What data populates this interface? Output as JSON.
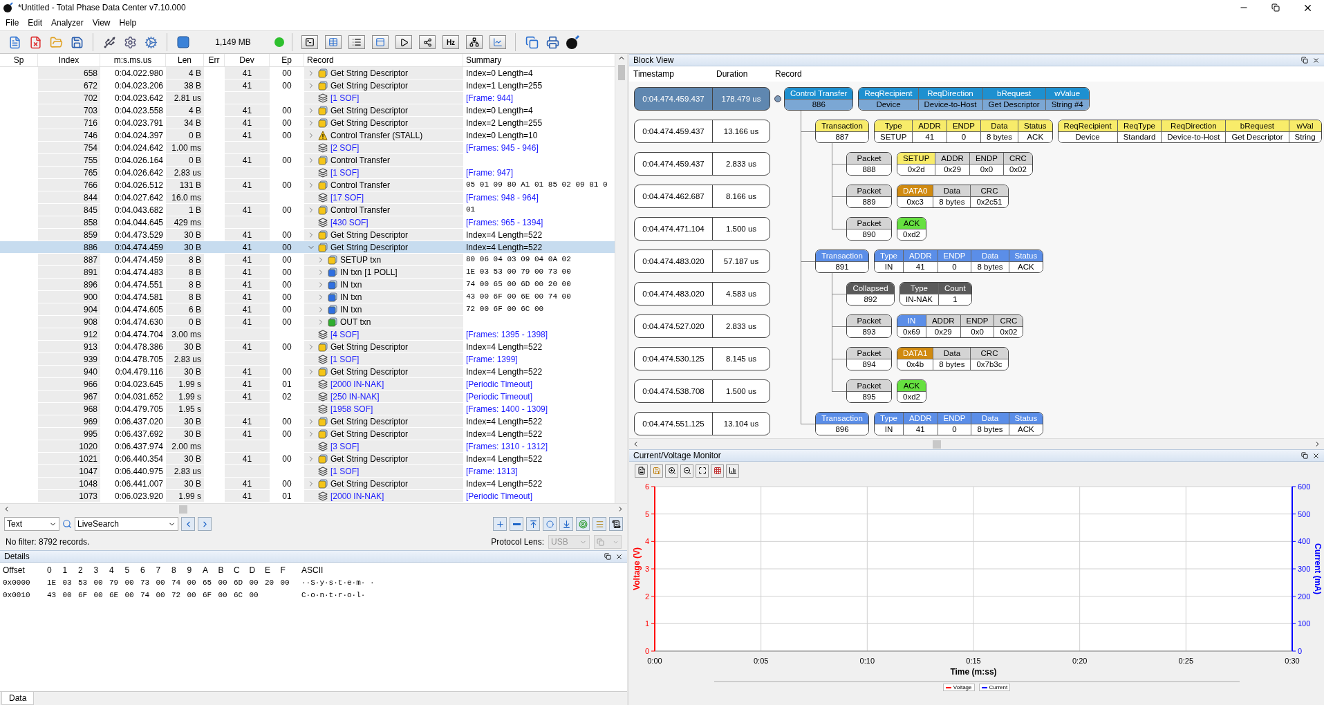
{
  "window": {
    "title": "*Untitled - Total Phase Data Center v7.10.000"
  },
  "menu": [
    "File",
    "Edit",
    "Analyzer",
    "View",
    "Help"
  ],
  "toolbar": {
    "memory": "1,149 MB",
    "frequency_label": "Hz"
  },
  "table": {
    "columns": [
      "Sp",
      "Index",
      "m:s.ms.us",
      "Len",
      "Err",
      "Dev",
      "Ep",
      "Record",
      "Summary"
    ],
    "rows": [
      {
        "index": "658",
        "time": "0:04.022.980",
        "len": "4 B",
        "dev": "41",
        "ep": "00",
        "kind": "transfer",
        "record": "Get String Descriptor",
        "summary": "Index=0 Length=4",
        "summary_mono": false,
        "selected": false,
        "expanded": false
      },
      {
        "index": "672",
        "time": "0:04.023.206",
        "len": "38 B",
        "dev": "41",
        "ep": "00",
        "kind": "transfer",
        "record": "Get String Descriptor",
        "summary": "Index=1 Length=255",
        "summary_mono": false,
        "selected": false,
        "expanded": false
      },
      {
        "index": "702",
        "time": "0:04.023.642",
        "len": "2.81 us",
        "kind": "sof",
        "record": "[1 SOF]",
        "summary": "[Frame: 944]",
        "summary_mono": false,
        "selected": false
      },
      {
        "index": "703",
        "time": "0:04.023.558",
        "len": "4 B",
        "dev": "41",
        "ep": "00",
        "kind": "transfer",
        "record": "Get String Descriptor",
        "summary": "Index=0 Length=4",
        "summary_mono": false,
        "selected": false,
        "expanded": false
      },
      {
        "index": "716",
        "time": "0:04.023.791",
        "len": "34 B",
        "dev": "41",
        "ep": "00",
        "kind": "transfer",
        "record": "Get String Descriptor",
        "summary": "Index=2 Length=255",
        "summary_mono": false,
        "selected": false,
        "expanded": false
      },
      {
        "index": "746",
        "time": "0:04.024.397",
        "len": "0 B",
        "dev": "41",
        "ep": "00",
        "kind": "stall",
        "record": "Control Transfer (STALL)",
        "summary": "Index=0 Length=10",
        "summary_mono": false,
        "selected": false,
        "expanded": false
      },
      {
        "index": "754",
        "time": "0:04.024.642",
        "len": "1.00 ms",
        "kind": "sof",
        "record": "[2 SOF]",
        "summary": "[Frames: 945 - 946]",
        "summary_mono": false,
        "selected": false
      },
      {
        "index": "755",
        "time": "0:04.026.164",
        "len": "0 B",
        "dev": "41",
        "ep": "00",
        "kind": "transfer",
        "record": "Control Transfer",
        "selected": false,
        "expanded": false
      },
      {
        "index": "765",
        "time": "0:04.026.642",
        "len": "2.83 us",
        "kind": "sof",
        "record": "[1 SOF]",
        "summary": "[Frame: 947]",
        "summary_mono": false,
        "selected": false
      },
      {
        "index": "766",
        "time": "0:04.026.512",
        "len": "131 B",
        "dev": "41",
        "ep": "00",
        "kind": "transfer",
        "record": "Control Transfer",
        "summary": "05 01 09 80 A1 01 85 02 09 81 0",
        "summary_mono": true,
        "selected": false,
        "expanded": false
      },
      {
        "index": "844",
        "time": "0:04.027.642",
        "len": "16.0 ms",
        "kind": "sof",
        "record": "[17 SOF]",
        "summary": "[Frames: 948 - 964]",
        "summary_mono": false,
        "selected": false
      },
      {
        "index": "845",
        "time": "0:04.043.682",
        "len": "1 B",
        "dev": "41",
        "ep": "00",
        "kind": "transfer",
        "record": "Control Transfer",
        "summary": "01",
        "summary_mono": true,
        "selected": false,
        "expanded": false
      },
      {
        "index": "858",
        "time": "0:04.044.645",
        "len": "429 ms",
        "kind": "sof",
        "record": "[430 SOF]",
        "summary": "[Frames: 965 - 1394]",
        "summary_mono": false,
        "selected": false
      },
      {
        "index": "859",
        "time": "0:04.473.529",
        "len": "30 B",
        "dev": "41",
        "ep": "00",
        "kind": "transfer",
        "record": "Get String Descriptor",
        "summary": "Index=4 Length=522",
        "summary_mono": false,
        "selected": false,
        "expanded": false
      },
      {
        "index": "886",
        "time": "0:04.474.459",
        "len": "30 B",
        "dev": "41",
        "ep": "00",
        "kind": "transfer",
        "record": "Get String Descriptor",
        "summary": "Index=4 Length=522",
        "summary_mono": false,
        "selected": true,
        "expanded": true,
        "children": [
          {
            "index": "887",
            "time": "0:04.474.459",
            "len": "8 B",
            "dev": "41",
            "ep": "00",
            "kind": "setup",
            "record": "SETUP txn",
            "summary": "80 06 04 03 09 04 0A 02",
            "summary_mono": true,
            "selected": false,
            "expanded": false
          },
          {
            "index": "891",
            "time": "0:04.474.483",
            "len": "8 B",
            "dev": "41",
            "ep": "00",
            "kind": "in",
            "record": "IN txn",
            "tag": "[1 POLL]",
            "summary": "1E 03 53 00 79 00 73 00",
            "summary_mono": true,
            "selected": false,
            "expanded": false
          },
          {
            "index": "896",
            "time": "0:04.474.551",
            "len": "8 B",
            "dev": "41",
            "ep": "00",
            "kind": "in",
            "record": "IN txn",
            "summary": "74 00 65 00 6D 00 20 00",
            "summary_mono": true,
            "selected": false,
            "expanded": false
          },
          {
            "index": "900",
            "time": "0:04.474.581",
            "len": "8 B",
            "dev": "41",
            "ep": "00",
            "kind": "in",
            "record": "IN txn",
            "summary": "43 00 6F 00 6E 00 74 00",
            "summary_mono": true,
            "selected": false,
            "expanded": false
          },
          {
            "index": "904",
            "time": "0:04.474.605",
            "len": "6 B",
            "dev": "41",
            "ep": "00",
            "kind": "in",
            "record": "IN txn",
            "summary": "72 00 6F 00 6C 00",
            "summary_mono": true,
            "selected": false,
            "expanded": false
          },
          {
            "index": "908",
            "time": "0:04.474.630",
            "len": "0 B",
            "dev": "41",
            "ep": "00",
            "kind": "out",
            "record": "OUT txn",
            "selected": false,
            "expanded": false
          }
        ]
      },
      {
        "index": "912",
        "time": "0:04.474.704",
        "len": "3.00 ms",
        "kind": "sof",
        "record": "[4 SOF]",
        "summary": "[Frames: 1395 - 1398]",
        "summary_mono": false,
        "selected": false
      },
      {
        "index": "913",
        "time": "0:04.478.386",
        "len": "30 B",
        "dev": "41",
        "ep": "00",
        "kind": "transfer",
        "record": "Get String Descriptor",
        "summary": "Index=4 Length=522",
        "summary_mono": false,
        "selected": false,
        "expanded": false
      },
      {
        "index": "939",
        "time": "0:04.478.705",
        "len": "2.83 us",
        "kind": "sof",
        "record": "[1 SOF]",
        "summary": "[Frame: 1399]",
        "summary_mono": false,
        "selected": false
      },
      {
        "index": "940",
        "time": "0:04.479.116",
        "len": "30 B",
        "dev": "41",
        "ep": "00",
        "kind": "transfer",
        "record": "Get String Descriptor",
        "summary": "Index=4 Length=522",
        "summary_mono": false,
        "selected": false,
        "expanded": false
      },
      {
        "index": "966",
        "time": "0:04.023.645",
        "len": "1.99 s",
        "dev": "41",
        "ep": "01",
        "kind": "sof",
        "record": "[2000 IN-NAK]",
        "summary": "[Periodic Timeout]",
        "summary_mono": false,
        "selected": false
      },
      {
        "index": "967",
        "time": "0:04.031.652",
        "len": "1.99 s",
        "dev": "41",
        "ep": "02",
        "kind": "sof",
        "record": "[250 IN-NAK]",
        "summary": "[Periodic Timeout]",
        "summary_mono": false,
        "selected": false
      },
      {
        "index": "968",
        "time": "0:04.479.705",
        "len": "1.95 s",
        "kind": "sof",
        "record": "[1958 SOF]",
        "summary": "[Frames: 1400 - 1309]",
        "summary_mono": false,
        "selected": false
      },
      {
        "index": "969",
        "time": "0:06.437.020",
        "len": "30 B",
        "dev": "41",
        "ep": "00",
        "kind": "transfer",
        "record": "Get String Descriptor",
        "summary": "Index=4 Length=522",
        "summary_mono": false,
        "selected": false,
        "expanded": false
      },
      {
        "index": "995",
        "time": "0:06.437.692",
        "len": "30 B",
        "dev": "41",
        "ep": "00",
        "kind": "transfer",
        "record": "Get String Descriptor",
        "summary": "Index=4 Length=522",
        "summary_mono": false,
        "selected": false,
        "expanded": false
      },
      {
        "index": "1020",
        "time": "0:06.437.974",
        "len": "2.00 ms",
        "kind": "sof",
        "record": "[3 SOF]",
        "summary": "[Frames: 1310 - 1312]",
        "summary_mono": false,
        "selected": false
      },
      {
        "index": "1021",
        "time": "0:06.440.354",
        "len": "30 B",
        "dev": "41",
        "ep": "00",
        "kind": "transfer",
        "record": "Get String Descriptor",
        "summary": "Index=4 Length=522",
        "summary_mono": false,
        "selected": false,
        "expanded": false
      },
      {
        "index": "1047",
        "time": "0:06.440.975",
        "len": "2.83 us",
        "kind": "sof",
        "record": "[1 SOF]",
        "summary": "[Frame: 1313]",
        "summary_mono": false,
        "selected": false
      },
      {
        "index": "1048",
        "time": "0:06.441.007",
        "len": "30 B",
        "dev": "41",
        "ep": "00",
        "kind": "transfer",
        "record": "Get String Descriptor",
        "summary": "Index=4 Length=522",
        "summary_mono": false,
        "selected": false,
        "expanded": false
      },
      {
        "index": "1073",
        "time": "0:06.023.920",
        "len": "1.99 s",
        "dev": "41",
        "ep": "01",
        "kind": "sof",
        "record": "[2000 IN-NAK]",
        "summary": "[Periodic Timeout]",
        "summary_mono": false,
        "selected": false
      }
    ]
  },
  "search": {
    "mode": "Text",
    "value": "LiveSearch"
  },
  "status": {
    "text": "No filter: 8792 records.",
    "lens_label": "Protocol Lens:",
    "lens_value": "USB",
    "lens_disabled": true
  },
  "details": {
    "title": "Details",
    "columns": [
      "Offset",
      "0",
      "1",
      "2",
      "3",
      "4",
      "5",
      "6",
      "7",
      "8",
      "9",
      "A",
      "B",
      "C",
      "D",
      "E",
      "F",
      "ASCII"
    ],
    "rows": [
      {
        "offset": "0x0000",
        "bytes": [
          "1E",
          "03",
          "53",
          "00",
          "79",
          "00",
          "73",
          "00",
          "74",
          "00",
          "65",
          "00",
          "6D",
          "00",
          "20",
          "00"
        ],
        "ascii": "··S·y·s·t·e·m· ·"
      },
      {
        "offset": "0x0010",
        "bytes": [
          "43",
          "00",
          "6F",
          "00",
          "6E",
          "00",
          "74",
          "00",
          "72",
          "00",
          "6F",
          "00",
          "6C",
          "00"
        ],
        "ascii": "C·o·n·t·r·o·l·"
      }
    ]
  },
  "bottom_tabs": [
    {
      "label": "Data",
      "selected": true
    }
  ],
  "block_view": {
    "title": "Block View",
    "columns": [
      "Timestamp",
      "Duration",
      "Record"
    ],
    "nodes": [
      {
        "kind": "transfer",
        "timestamp": "0:04.474.459.437",
        "duration": "178.479 us",
        "selected": true,
        "title": "Control Transfer",
        "id": "886",
        "color": "#1e90d0",
        "groups": [
          [
            {
              "label": "ReqRecipient",
              "value": "Device",
              "color": "#1e90d0"
            },
            {
              "label": "ReqDirection",
              "value": "Device-to-Host",
              "color": "#1e90d0"
            },
            {
              "label": "bRequest",
              "value": "Get Descriptor",
              "color": "#1e90d0"
            },
            {
              "label": "wValue",
              "value": "String #4",
              "color": "#1e90d0"
            }
          ]
        ],
        "children": [
          {
            "kind": "transaction",
            "timestamp": "0:04.474.459.437",
            "duration": "13.166 us",
            "selected": false,
            "title": "Transaction",
            "id": "887",
            "color": "#f8ec6a",
            "groups": [
              [
                {
                  "label": "Type",
                  "value": "SETUP",
                  "color": "#f8ec6a"
                },
                {
                  "label": "ADDR",
                  "value": "41",
                  "color": "#f8ec6a"
                },
                {
                  "label": "ENDP",
                  "value": "0",
                  "color": "#f8ec6a"
                },
                {
                  "label": "Data",
                  "value": "8 bytes",
                  "color": "#f8ec6a"
                },
                {
                  "label": "Status",
                  "value": "ACK",
                  "color": "#f8ec6a"
                }
              ],
              [
                {
                  "label": "ReqRecipient",
                  "value": "Device",
                  "color": "#f8ec6a"
                },
                {
                  "label": "ReqType",
                  "value": "Standard",
                  "color": "#f8ec6a"
                },
                {
                  "label": "ReqDirection",
                  "value": "Device-to-Host",
                  "color": "#f8ec6a"
                },
                {
                  "label": "bRequest",
                  "value": "Get Descriptor",
                  "color": "#f8ec6a"
                },
                {
                  "label": "wVal",
                  "value": "String",
                  "color": "#f8ec6a"
                }
              ]
            ],
            "children": [
              {
                "kind": "packet",
                "timestamp": "0:04.474.459.437",
                "duration": "2.833 us",
                "selected": false,
                "title": "Packet",
                "id": "888",
                "color": "#d4d4d4",
                "groups": [
                  [
                    {
                      "label": "SETUP",
                      "value": "0x2d",
                      "color": "#f8ec6a"
                    },
                    {
                      "label": "ADDR",
                      "value": "0x29",
                      "color": "#d4d4d4"
                    },
                    {
                      "label": "ENDP",
                      "value": "0x0",
                      "color": "#d4d4d4"
                    },
                    {
                      "label": "CRC",
                      "value": "0x02",
                      "color": "#d4d4d4"
                    }
                  ]
                ]
              },
              {
                "kind": "packet",
                "timestamp": "0:04.474.462.687",
                "duration": "8.166 us",
                "selected": false,
                "title": "Packet",
                "id": "889",
                "color": "#d4d4d4",
                "groups": [
                  [
                    {
                      "label": "DATA0",
                      "value": "0xc3",
                      "color": "#d08a10"
                    },
                    {
                      "label": "Data",
                      "value": "8 bytes",
                      "color": "#d4d4d4"
                    },
                    {
                      "label": "CRC",
                      "value": "0x2c51",
                      "color": "#d4d4d4"
                    }
                  ]
                ]
              },
              {
                "kind": "packet",
                "timestamp": "0:04.474.471.104",
                "duration": "1.500 us",
                "selected": false,
                "title": "Packet",
                "id": "890",
                "color": "#d4d4d4",
                "groups": [
                  [
                    {
                      "label": "ACK",
                      "value": "0xd2",
                      "color": "#66e040"
                    }
                  ]
                ]
              }
            ]
          },
          {
            "kind": "transaction",
            "timestamp": "0:04.474.483.020",
            "duration": "57.187 us",
            "selected": false,
            "title": "Transaction",
            "id": "891",
            "color": "#5b8ee8",
            "groups": [
              [
                {
                  "label": "Type",
                  "value": "IN",
                  "color": "#5b8ee8"
                },
                {
                  "label": "ADDR",
                  "value": "41",
                  "color": "#5b8ee8"
                },
                {
                  "label": "ENDP",
                  "value": "0",
                  "color": "#5b8ee8"
                },
                {
                  "label": "Data",
                  "value": "8 bytes",
                  "color": "#5b8ee8"
                },
                {
                  "label": "Status",
                  "value": "ACK",
                  "color": "#5b8ee8"
                }
              ]
            ],
            "children": [
              {
                "kind": "collapsed",
                "timestamp": "0:04.474.483.020",
                "duration": "4.583 us",
                "selected": false,
                "title": "Collapsed",
                "id": "892",
                "color": "#5a5a5a",
                "groups": [
                  [
                    {
                      "label": "Type",
                      "value": "IN-NAK",
                      "color": "#5a5a5a"
                    },
                    {
                      "label": "Count",
                      "value": "1",
                      "color": "#5a5a5a"
                    }
                  ]
                ]
              },
              {
                "kind": "packet",
                "timestamp": "0:04.474.527.020",
                "duration": "2.833 us",
                "selected": false,
                "title": "Packet",
                "id": "893",
                "color": "#d4d4d4",
                "groups": [
                  [
                    {
                      "label": "IN",
                      "value": "0x69",
                      "color": "#5b8ee8"
                    },
                    {
                      "label": "ADDR",
                      "value": "0x29",
                      "color": "#d4d4d4"
                    },
                    {
                      "label": "ENDP",
                      "value": "0x0",
                      "color": "#d4d4d4"
                    },
                    {
                      "label": "CRC",
                      "value": "0x02",
                      "color": "#d4d4d4"
                    }
                  ]
                ]
              },
              {
                "kind": "packet",
                "timestamp": "0:04.474.530.125",
                "duration": "8.145 us",
                "selected": false,
                "title": "Packet",
                "id": "894",
                "color": "#d4d4d4",
                "groups": [
                  [
                    {
                      "label": "DATA1",
                      "value": "0x4b",
                      "color": "#d08a10"
                    },
                    {
                      "label": "Data",
                      "value": "8 bytes",
                      "color": "#d4d4d4"
                    },
                    {
                      "label": "CRC",
                      "value": "0x7b3c",
                      "color": "#d4d4d4"
                    }
                  ]
                ]
              },
              {
                "kind": "packet",
                "timestamp": "0:04.474.538.708",
                "duration": "1.500 us",
                "selected": false,
                "title": "Packet",
                "id": "895",
                "color": "#d4d4d4",
                "groups": [
                  [
                    {
                      "label": "ACK",
                      "value": "0xd2",
                      "color": "#66e040"
                    }
                  ]
                ]
              }
            ]
          },
          {
            "kind": "transaction",
            "timestamp": "0:04.474.551.125",
            "duration": "13.104 us",
            "selected": false,
            "title": "Transaction",
            "id": "896",
            "color": "#5b8ee8",
            "groups": [
              [
                {
                  "label": "Type",
                  "value": "IN",
                  "color": "#5b8ee8"
                },
                {
                  "label": "ADDR",
                  "value": "41",
                  "color": "#5b8ee8"
                },
                {
                  "label": "ENDP",
                  "value": "0",
                  "color": "#5b8ee8"
                },
                {
                  "label": "Data",
                  "value": "8 bytes",
                  "color": "#5b8ee8"
                },
                {
                  "label": "Status",
                  "value": "ACK",
                  "color": "#5b8ee8"
                }
              ]
            ]
          }
        ]
      }
    ]
  },
  "monitor": {
    "title": "Current/Voltage Monitor",
    "chart_data": {
      "type": "line",
      "xlabel": "Time (m:ss)",
      "ylabel": "Voltage (V)",
      "y2label": "Current (mA)",
      "grid": true,
      "ylim": [
        0,
        6
      ],
      "y2lim": [
        0,
        600
      ],
      "categories": [
        "0:00",
        "0:05",
        "0:10",
        "0:15",
        "0:20",
        "0:25",
        "0:30"
      ],
      "yticks": [
        0,
        1,
        2,
        3,
        4,
        5,
        6
      ],
      "y2ticks": [
        0,
        100,
        200,
        300,
        400,
        500,
        600
      ],
      "series": [
        {
          "name": "Voltage",
          "color": "#ff0000",
          "values": [
            null,
            null,
            null,
            null,
            null,
            null,
            null
          ]
        },
        {
          "name": "Current",
          "color": "#0000ff",
          "values": [
            null,
            null,
            null,
            null,
            null,
            null,
            null
          ]
        }
      ]
    }
  }
}
